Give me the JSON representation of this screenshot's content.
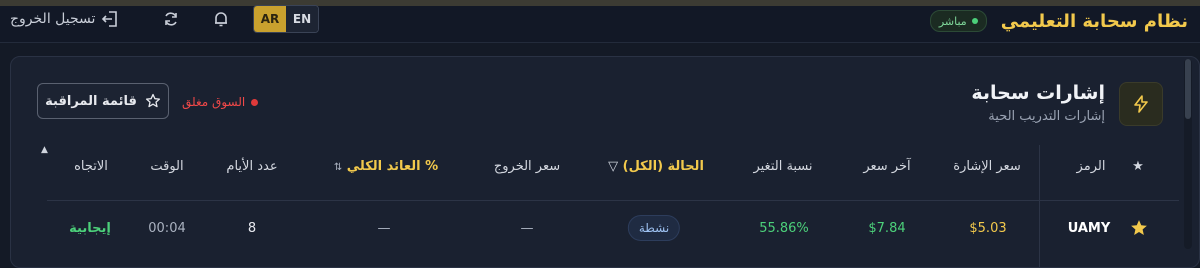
{
  "header": {
    "brand_title": "نظام سحابة التعليمي",
    "live_label": "مباشر",
    "logout_label": "تسجيل الخروج",
    "lang_ar": "AR",
    "lang_en": "EN"
  },
  "panel": {
    "title": "إشارات سحابة",
    "subtitle": "إشارات التدريب الحية",
    "watchlist_label": "قائمة المراقبة",
    "market_status": "السوق مغلق"
  },
  "table": {
    "headers": {
      "star": "★",
      "symbol": "الرمز",
      "signal_price": "سعر الإشارة",
      "last_price": "آخر سعر",
      "change_pct": "نسبة التغير",
      "status": "الحالة (الكل)",
      "exit_price": "سعر الخروج",
      "total_return": "العائد الكلي %",
      "days": "عدد الأيام",
      "time": "الوقت",
      "direction": "الاتجاه"
    },
    "rows": [
      {
        "symbol": "UAMY",
        "signal_price": "$5.03",
        "last_price": "$7.84",
        "change_pct": "55.86%",
        "status": "نشطة",
        "exit_price": "—",
        "total_return": "—",
        "days": "8",
        "time": "00:04",
        "direction": "إيجابية"
      }
    ]
  },
  "colors": {
    "accent_gold": "#f2c94c",
    "positive_green": "#4cd07a",
    "market_closed_red": "#e03a3a"
  },
  "icons": [
    "lightning-icon",
    "star-icon",
    "logout-icon",
    "refresh-icon",
    "bell-icon",
    "filter-icon",
    "sort-icon"
  ]
}
